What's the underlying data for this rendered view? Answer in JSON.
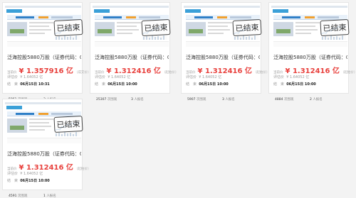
{
  "stamp_text": "已结束",
  "labels": {
    "deal_price": "当前价",
    "eval_price": "评估价",
    "time": "结　束"
  },
  "cards": [
    {
      "title": "泛海控股5880万股（证券代码：0000...",
      "price": "¥ 1.357916 亿",
      "price_note": "（成交价）",
      "eval": "¥ 1.64052 亿",
      "end_time": "06月15日 10:31",
      "views_count": "5861",
      "views_label": "次围观",
      "sign_count": "3",
      "sign_label": "人报名"
    },
    {
      "title": "泛海控股5880万股（证券代码：0000...",
      "price": "¥ 1.312416 亿",
      "price_note": "（起拍价）",
      "eval": "¥ 1.64052 亿",
      "end_time": "06月15日 10:00",
      "views_count": "25307",
      "views_label": "次围观",
      "sign_count": "3",
      "sign_label": "人报名"
    },
    {
      "title": "泛海控股5880万股（证券代码：0000...",
      "price": "¥ 1.312416 亿",
      "price_note": "（起拍价）",
      "eval": "¥ 1.64052 亿",
      "end_time": "06月15日 10:00",
      "views_count": "5907",
      "views_label": "次围观",
      "sign_count": "3",
      "sign_label": "人报名"
    },
    {
      "title": "泛海控股5880万股（证券代码：0000...",
      "price": "¥ 1.312416 亿",
      "price_note": "（起拍价）",
      "eval": "¥ 1.64052 亿",
      "end_time": "06月15日 10:00",
      "views_count": "4884",
      "views_label": "次围观",
      "sign_count": "2",
      "sign_label": "人报名"
    },
    {
      "title": "泛海控股5880万股（证券代码：0000...",
      "price": "¥ 1.312416 亿",
      "price_note": "（起拍价）",
      "eval": "¥ 1.64052 亿",
      "end_time": "06月15日 10:00",
      "views_count": "4591",
      "views_label": "次围观",
      "sign_count": "1",
      "sign_label": "人报名"
    }
  ],
  "colors": {
    "price": "#e8413d",
    "accent": "#3aa0d8"
  }
}
